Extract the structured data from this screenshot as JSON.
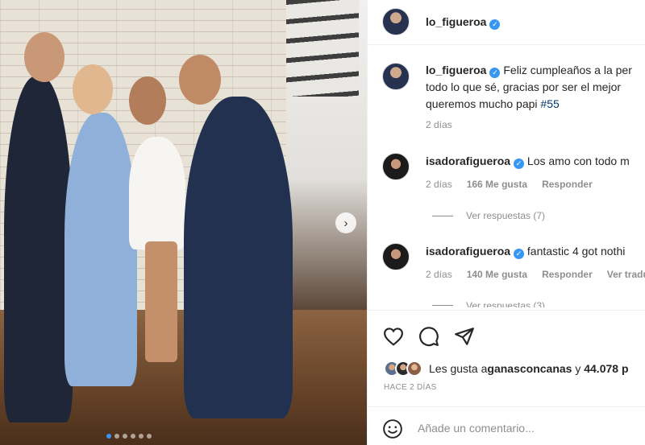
{
  "post": {
    "author": "lo_figueroa",
    "caption_lines": [
      "Feliz cumpleaños a la per",
      "todo lo que sé, gracias por ser el mejor",
      "queremos mucho papi "
    ],
    "hashtag": "#55",
    "caption_time": "2 días",
    "carousel": {
      "total": 6,
      "active": 1
    },
    "next_icon": "chevron-right-icon"
  },
  "comments": [
    {
      "user": "isadorafigueroa",
      "text": "Los amo con todo m",
      "time": "2 días",
      "likes": "166 Me gusta",
      "reply": "Responder",
      "translate": "",
      "view_replies": "Ver respuestas (7)"
    },
    {
      "user": "isadorafigueroa",
      "text": "fantastic 4 got nothi",
      "time": "2 días",
      "likes": "140 Me gusta",
      "reply": "Responder",
      "translate": "Ver tradu",
      "view_replies": "Ver respuestas (3)"
    }
  ],
  "actions": {
    "icons": [
      "heart-icon",
      "comment-icon",
      "share-icon"
    ]
  },
  "likes_summary": {
    "prefix": "Les gusta a ",
    "user": "ganasconcanas",
    "middle": " y ",
    "count": "44.078 p"
  },
  "time_ago": "HACE 2 DÍAS",
  "comment_box": {
    "placeholder": "Añade un comentario...",
    "icon": "emoji-icon"
  },
  "colors": {
    "accent": "#3897f0",
    "hashtag": "#00376b",
    "muted": "#8e8e8e"
  }
}
